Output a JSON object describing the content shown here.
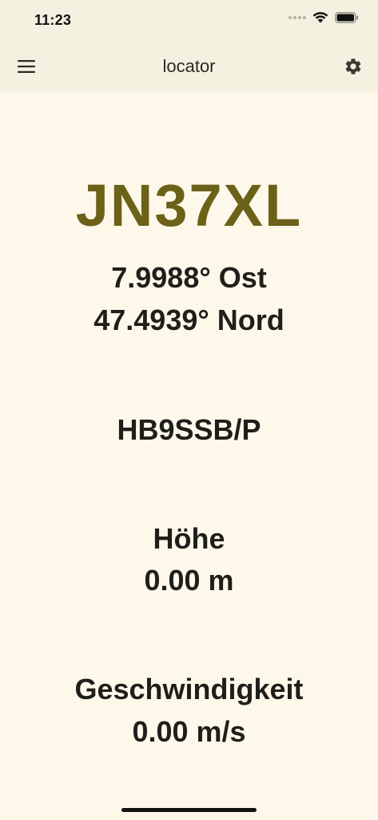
{
  "status_bar": {
    "time": "11:23"
  },
  "app_bar": {
    "title": "locator",
    "menu_icon": "hamburger-menu-icon",
    "settings_icon": "gear-icon"
  },
  "main": {
    "locator": "JN37XL",
    "longitude": "7.9988° Ost",
    "latitude": "47.4939° Nord",
    "callsign": "HB9SSB/P",
    "altitude_label": "Höhe",
    "altitude_value": "0.00 m",
    "speed_label": "Geschwindigkeit",
    "speed_value": "0.00 m/s"
  },
  "colors": {
    "background": "#fdf8ea",
    "app_bar": "#f5f1e0",
    "locator_accent": "#6b6118",
    "text": "#1f1f1a"
  }
}
